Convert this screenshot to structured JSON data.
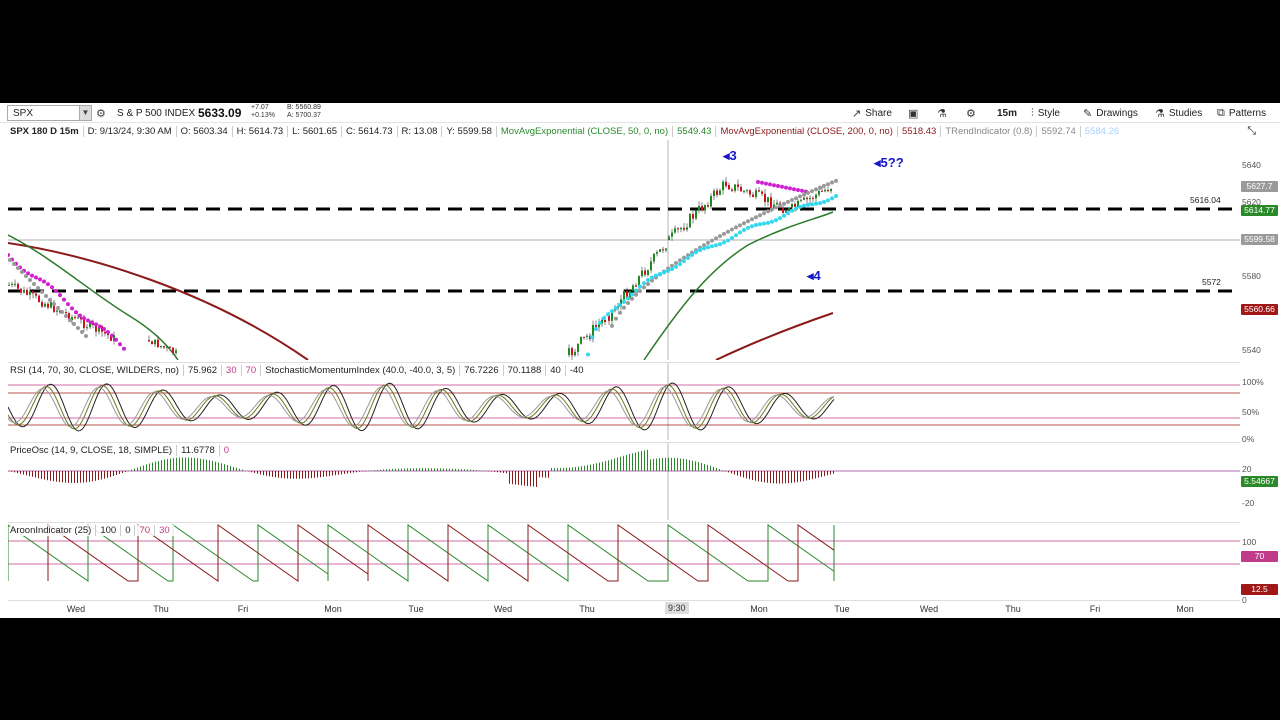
{
  "toolbar": {
    "symbol": "SPX",
    "name": "S & P 500 INDEX",
    "last": "5633.09",
    "change_abs": "+7.07",
    "change_pct": "+0.13%",
    "bid": "B: 5560.89",
    "ask": "A: 5700.37",
    "share_label": "Share",
    "interval_label": "15m",
    "style_label": "Style",
    "drawings_label": "Drawings",
    "studies_label": "Studies",
    "patterns_label": "Patterns"
  },
  "infobar": {
    "header": "SPX 180 D 15m",
    "date": "D: 9/13/24, 9:30 AM",
    "open": "O: 5603.34",
    "high": "H: 5614.73",
    "low": "L: 5601.65",
    "close": "C: 5614.73",
    "range": "R: 13.08",
    "y": "Y: 5599.58",
    "ma50_label": "MovAvgExponential (CLOSE, 50, 0, no)",
    "ma50_value": "5549.43",
    "ma200_label": "MovAvgExponential (CLOSE, 200, 0, no)",
    "ma200_value": "5518.43",
    "trend_label": "TRendIndicator (0.8)",
    "trend_v1": "5592.74",
    "trend_v2": "5584.26"
  },
  "price_axis": {
    "ticks": [
      "5640",
      "5620",
      "5580",
      "5540"
    ],
    "tags": {
      "last": "5627.7",
      "level_hi": "5614.77",
      "cursor": "5599.58",
      "ema200": "5560.66"
    },
    "colors": {
      "last": "#9a9a9a",
      "level_hi": "#2a8a2a",
      "cursor": "#9a9a9a",
      "ema200": "#a01818"
    }
  },
  "levels": [
    {
      "label": "5616.04"
    },
    {
      "label": "5572"
    }
  ],
  "annotations": [
    "◂3",
    "◂5??",
    "◂4"
  ],
  "rsi": {
    "label": "RSI (14, 70, 30, CLOSE, WILDERS, no)",
    "value": "75.962",
    "ob": "30",
    "os": "70",
    "smi_label": "StochasticMomentumIndex (40.0, -40.0, 3, 5)",
    "smi_v1": "76.7226",
    "smi_v2": "70.1188",
    "smi_v3": "40",
    "smi_v4": "-40",
    "axis": [
      "100%",
      "50%",
      "0%"
    ]
  },
  "price_osc": {
    "label": "PriceOsc (14, 9, CLOSE, 18, SIMPLE)",
    "value": "11.6778",
    "zero": "0",
    "axis": [
      "20",
      "-20"
    ],
    "tag": "5.54667"
  },
  "aroon": {
    "label": "AroonIndicator (25)",
    "v1": "100",
    "v2": "0",
    "v3": "70",
    "v4": "30",
    "axis": [
      "100",
      "0"
    ],
    "tag_hi": "70",
    "tag_lo": "12.5"
  },
  "time_axis": {
    "labels": [
      "Wed",
      "Thu",
      "Fri",
      "Mon",
      "Tue",
      "Wed",
      "Thu",
      "Mon",
      "Tue",
      "Wed",
      "Thu",
      "Fri",
      "Mon"
    ],
    "cursor": "9:30"
  }
}
